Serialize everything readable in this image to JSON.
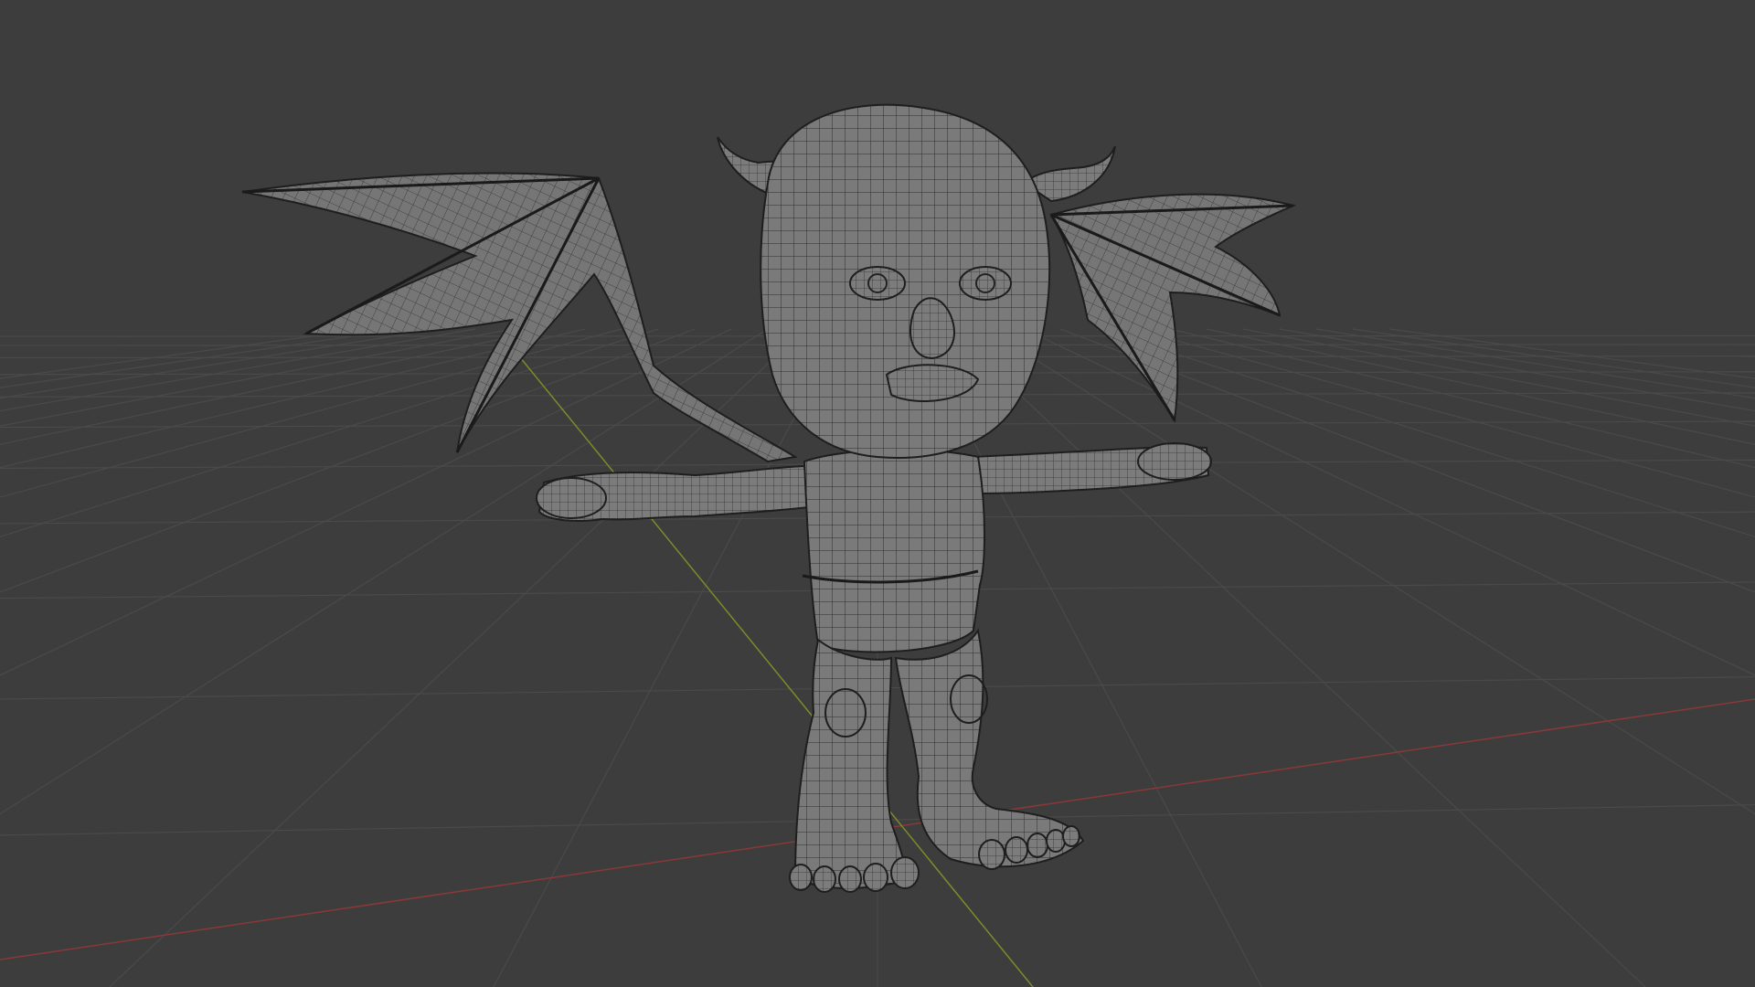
{
  "viewport": {
    "type": "3d-viewport",
    "background_color": "#3d3d3d",
    "grid_color": "#4a4a4a",
    "x_axis_color": "#8a3838",
    "y_axis_color": "#7f8a2a",
    "model_fill": "#777777",
    "wire_color": "#2a2a2a",
    "outline_color": "#1e1e1e",
    "shading": "wireframe-overlay",
    "model": {
      "description_icon": "creature-mesh-icon",
      "parts": [
        "head",
        "horn-left",
        "horn-right",
        "wing-left",
        "wing-right",
        "torso",
        "arm-left",
        "arm-right",
        "leg-left",
        "leg-right",
        "foot-left",
        "foot-right"
      ]
    }
  }
}
